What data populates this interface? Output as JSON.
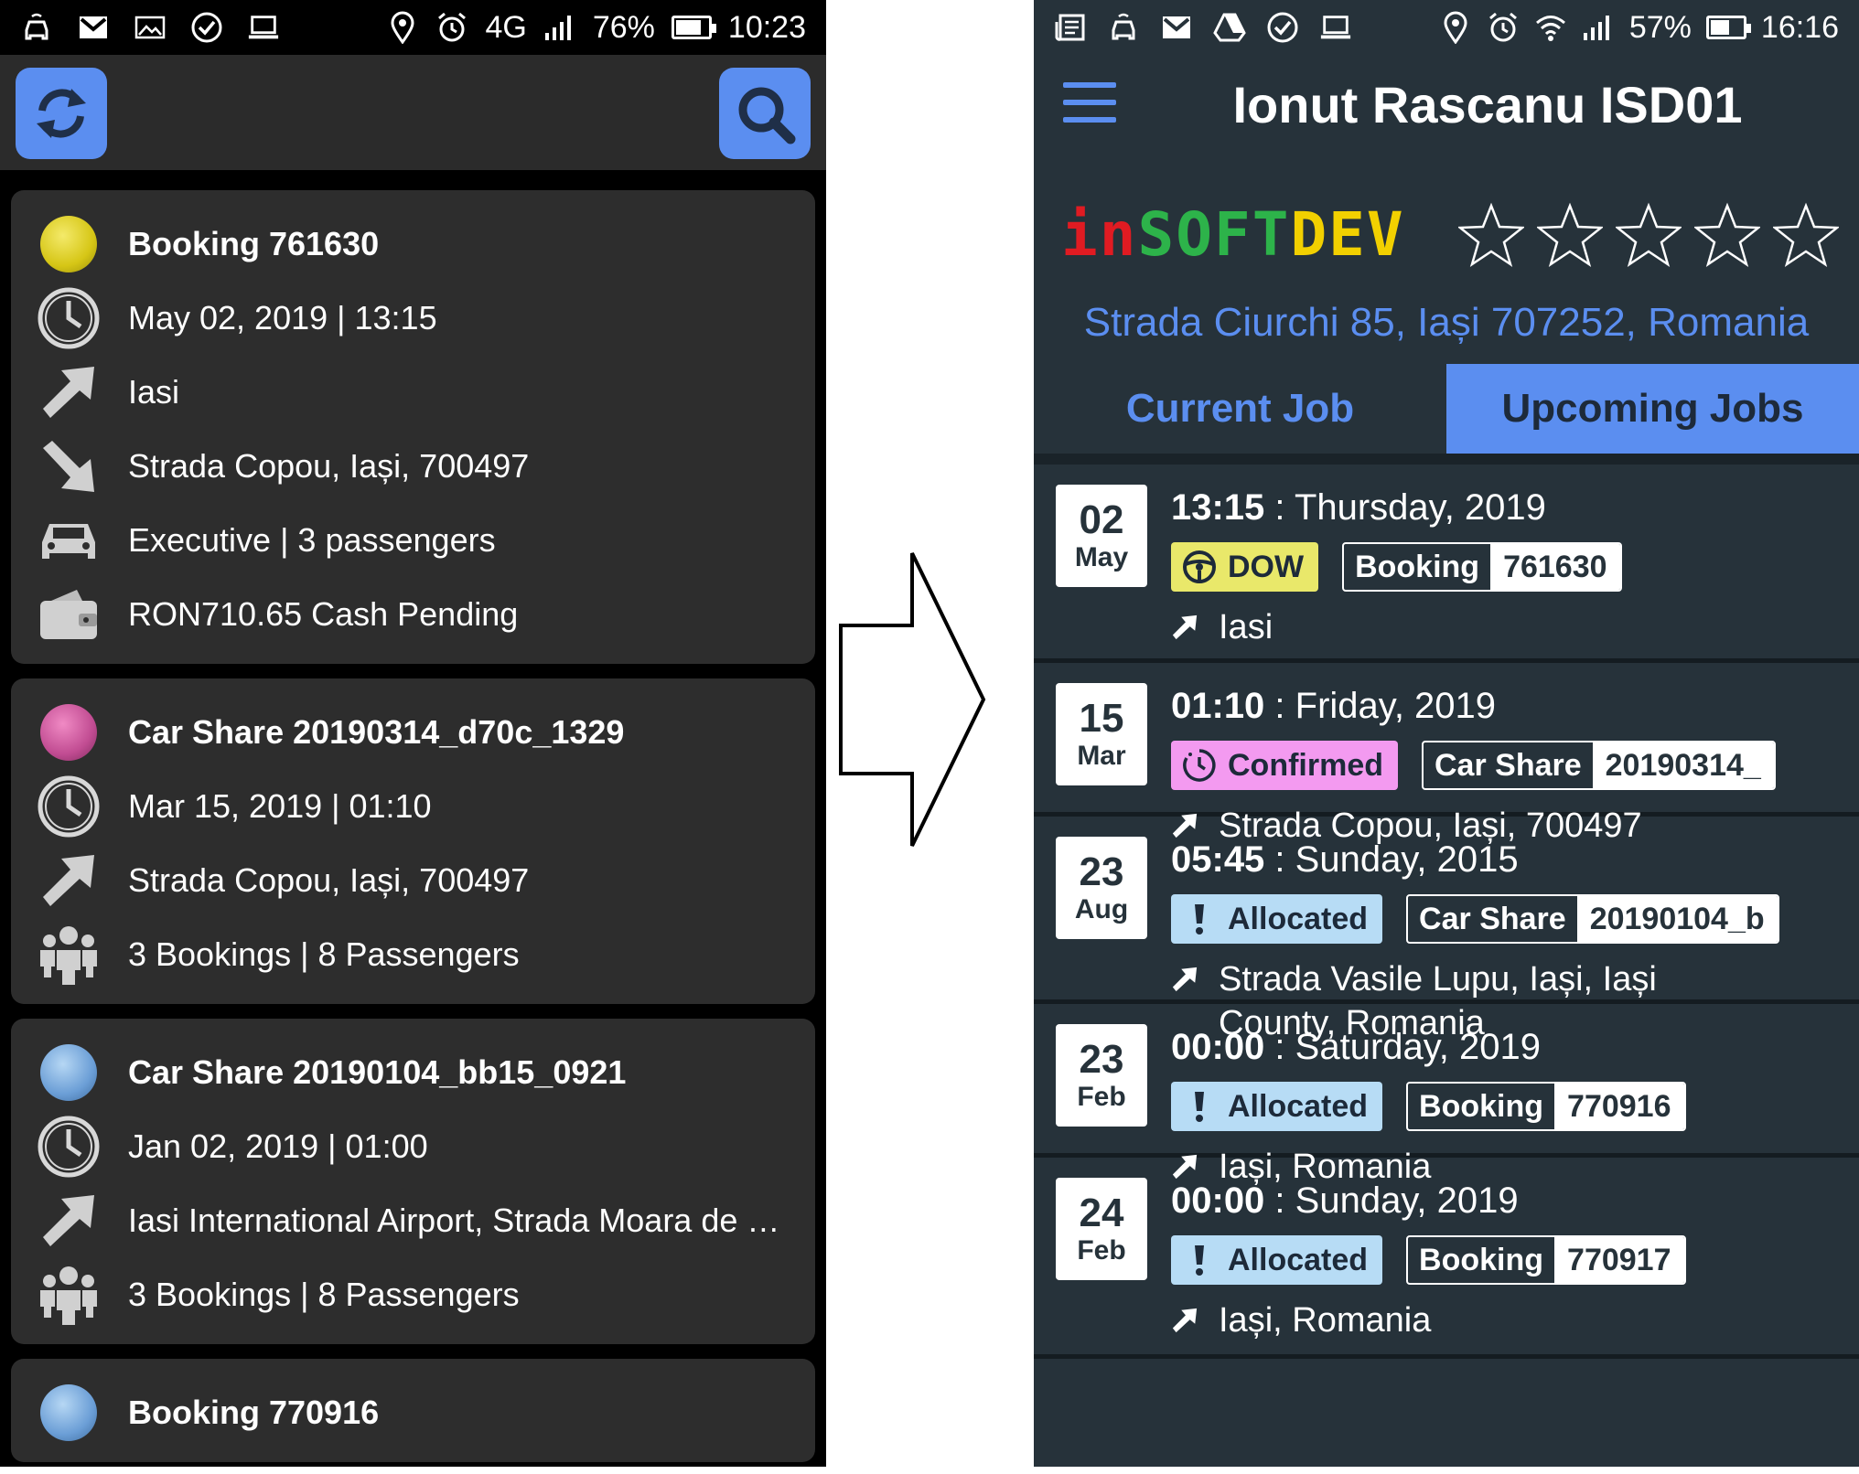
{
  "left_screen": {
    "status_bar": {
      "network": "4G",
      "battery": "76%",
      "time": "10:23"
    },
    "cards": [
      {
        "title": "Booking 761630",
        "dot_color": "#d6c616",
        "rows": [
          {
            "icon": "clock-icon",
            "text": "May 02, 2019 | 13:15"
          },
          {
            "icon": "pickup-arrow-icon",
            "text": "Iasi"
          },
          {
            "icon": "dropoff-arrow-icon",
            "text": "Strada Copou, Iași, 700497"
          },
          {
            "icon": "car-icon",
            "text": "Executive | 3 passengers"
          },
          {
            "icon": "wallet-icon",
            "text": "RON710.65  Cash  Pending"
          }
        ]
      },
      {
        "title": "Car Share 20190314_d70c_1329",
        "dot_color": "#c14c92",
        "rows": [
          {
            "icon": "clock-icon",
            "text": "Mar 15, 2019 | 01:10"
          },
          {
            "icon": "pickup-arrow-icon",
            "text": "Strada Copou, Iași, 700497"
          },
          {
            "icon": "people-icon",
            "text": "3 Bookings | 8 Passengers"
          }
        ]
      },
      {
        "title": "Car Share 20190104_bb15_0921",
        "dot_color": "#6b9ed6",
        "rows": [
          {
            "icon": "clock-icon",
            "text": "Jan 02, 2019 | 01:00"
          },
          {
            "icon": "pickup-arrow-icon",
            "text": "Iasi International Airport, Strada Moara de Vâ..."
          },
          {
            "icon": "people-icon",
            "text": "3 Bookings | 8 Passengers"
          }
        ]
      },
      {
        "title": "Booking 770916",
        "dot_color": "#6b9ed6",
        "rows": []
      }
    ]
  },
  "right_screen": {
    "status_bar": {
      "battery": "57%",
      "time": "16:16"
    },
    "header": {
      "title": "Ionut Rascanu ISD01"
    },
    "brand": {
      "logo_parts": [
        "in",
        "SOFT",
        "DEV"
      ],
      "rating_stars": 5,
      "rating_value": 0
    },
    "address": "Strada Ciurchi 85, Iași 707252, Romania",
    "tabs": [
      {
        "label": "Current Job",
        "active": false
      },
      {
        "label": "Upcoming Jobs",
        "active": true
      }
    ],
    "jobs": [
      {
        "day": "02",
        "month": "May",
        "time": "13:15",
        "when": "Thursday, 2019",
        "status": "DOW",
        "status_icon": "steering-wheel-icon",
        "status_color": "#e9e86a",
        "type": "Booking",
        "number": "761630",
        "dest": "Iasi"
      },
      {
        "day": "15",
        "month": "Mar",
        "time": "01:10",
        "when": "Friday, 2019",
        "status": "Confirmed",
        "status_icon": "clock-icon",
        "status_color": "#f39af0",
        "type": "Car Share",
        "number": "20190314_",
        "dest": "Strada Copou, Iași, 700497"
      },
      {
        "day": "23",
        "month": "Aug",
        "time": "05:45",
        "when": "Sunday, 2015",
        "status": "Allocated",
        "status_icon": "exclamation-icon",
        "status_color": "#b7dcf5",
        "type": "Car Share",
        "number": "20190104_b",
        "dest": "Strada Vasile Lupu, Iași, Iași County, Romania"
      },
      {
        "day": "23",
        "month": "Feb",
        "time": "00:00",
        "when": "Saturday, 2019",
        "status": "Allocated",
        "status_icon": "exclamation-icon",
        "status_color": "#b7dcf5",
        "type": "Booking",
        "number": "770916",
        "dest": "Iași, Romania"
      },
      {
        "day": "24",
        "month": "Feb",
        "time": "00:00",
        "when": "Sunday, 2019",
        "status": "Allocated",
        "status_icon": "exclamation-icon",
        "status_color": "#b7dcf5",
        "type": "Booking",
        "number": "770917",
        "dest": "Iași, Romania"
      }
    ]
  }
}
